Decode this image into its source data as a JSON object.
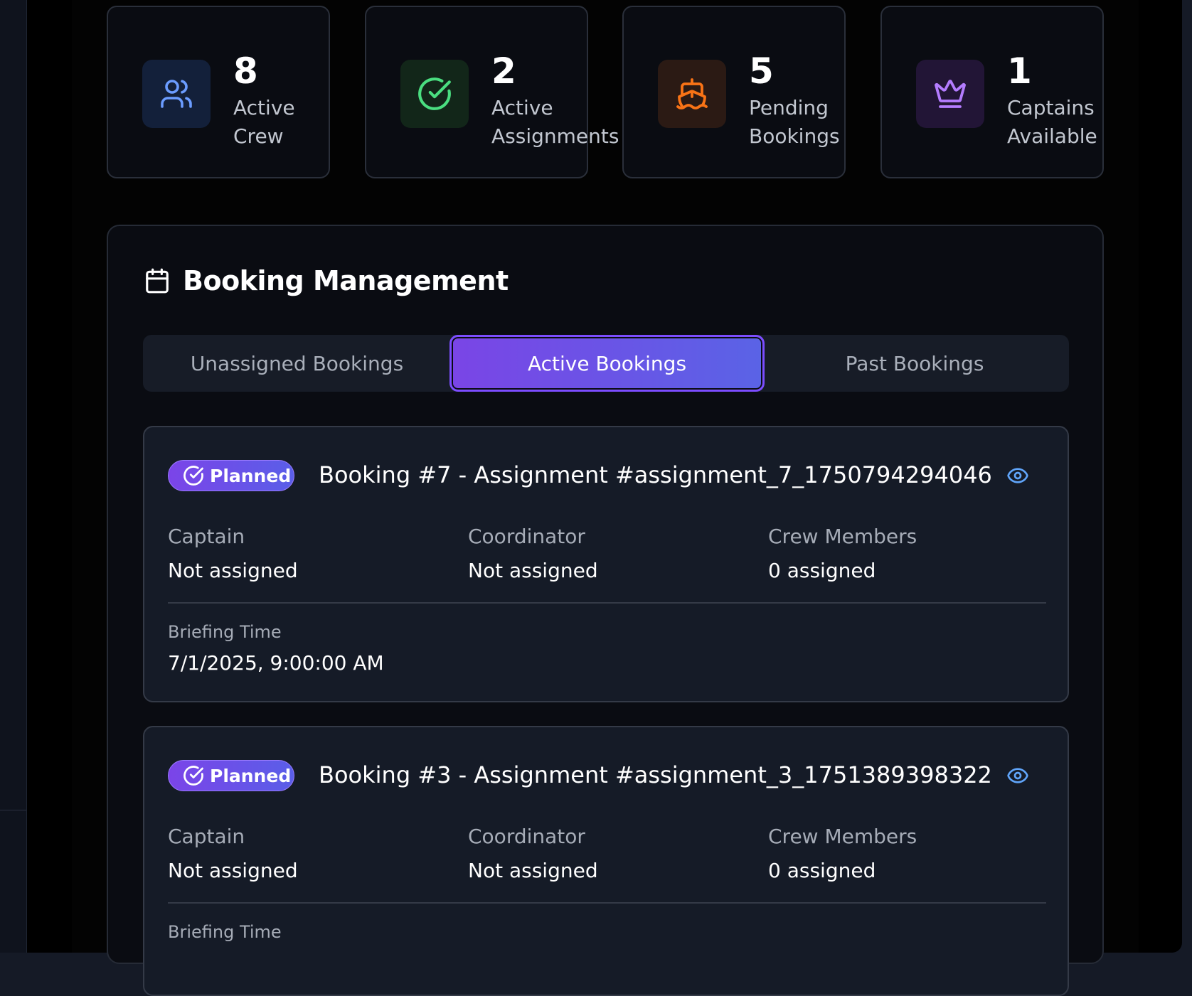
{
  "stats": [
    {
      "value": "8",
      "label": "Active Crew",
      "icon": "users-icon",
      "icon_bg": "#13203a",
      "icon_color": "#6b9cff"
    },
    {
      "value": "2",
      "label": "Active Assignments",
      "icon": "check-circle-icon",
      "icon_bg": "#122619",
      "icon_color": "#4ade80"
    },
    {
      "value": "5",
      "label": "Pending Bookings",
      "icon": "ship-icon",
      "icon_bg": "#2b1a14",
      "icon_color": "#f97316"
    },
    {
      "value": "1",
      "label": "Captains Available",
      "icon": "crown-icon",
      "icon_bg": "#221536",
      "icon_color": "#b47cff"
    }
  ],
  "panel": {
    "title": "Booking Management",
    "icon": "calendar-icon",
    "tabs": [
      {
        "label": "Unassigned Bookings",
        "active": false
      },
      {
        "label": "Active Bookings",
        "active": true
      },
      {
        "label": "Past Bookings",
        "active": false
      }
    ]
  },
  "bookings": [
    {
      "status": "Planned",
      "title": "Booking #7 - Assignment #assignment_7_1750794294046",
      "captain_label": "Captain",
      "captain_value": "Not assigned",
      "coordinator_label": "Coordinator",
      "coordinator_value": "Not assigned",
      "crew_label": "Crew Members",
      "crew_value": "0 assigned",
      "briefing_label": "Briefing Time",
      "briefing_value": "7/1/2025, 9:00:00 AM"
    },
    {
      "status": "Planned",
      "title": "Booking #3 - Assignment #assignment_3_1751389398322",
      "captain_label": "Captain",
      "captain_value": "Not assigned",
      "coordinator_label": "Coordinator",
      "coordinator_value": "Not assigned",
      "crew_label": "Crew Members",
      "crew_value": "0 assigned",
      "briefing_label": "Briefing Time",
      "briefing_value": ""
    }
  ],
  "colors": {
    "accent_purple": "#7c4dff",
    "eye_icon": "#60a5fa",
    "card_bg": "#151b27"
  }
}
